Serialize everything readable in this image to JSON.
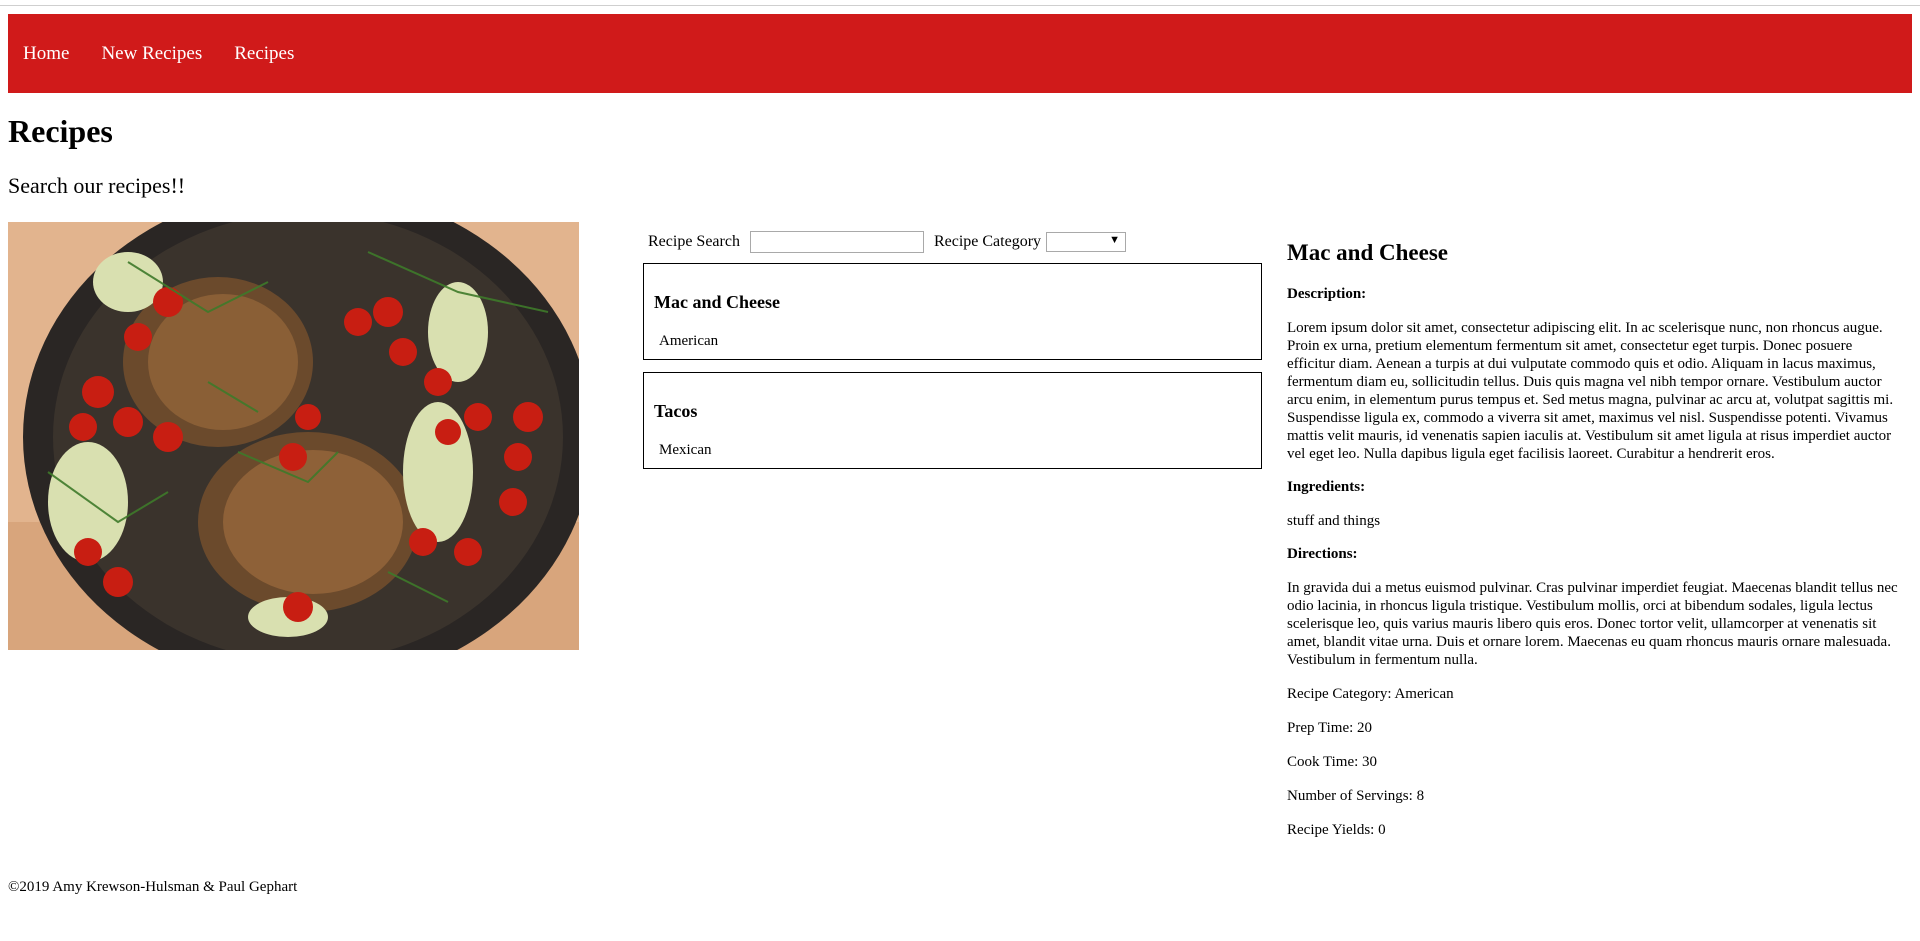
{
  "nav": {
    "items": [
      {
        "label": "Home"
      },
      {
        "label": "New Recipes"
      },
      {
        "label": "Recipes"
      }
    ]
  },
  "page": {
    "title": "Recipes",
    "subtitle": "Search our recipes!!"
  },
  "search": {
    "label": "Recipe Search",
    "value": "",
    "category_label": "Recipe Category",
    "category_value": ""
  },
  "recipes": [
    {
      "name": "Mac and Cheese",
      "category": "American"
    },
    {
      "name": "Tacos",
      "category": "Mexican"
    }
  ],
  "detail": {
    "title": "Mac and Cheese",
    "description_label": "Description:",
    "description": "Lorem ipsum dolor sit amet, consectetur adipiscing elit. In ac scelerisque nunc, non rhoncus augue. Proin ex urna, pretium elementum fermentum sit amet, consectetur eget turpis. Donec posuere efficitur diam. Aenean a turpis at dui vulputate commodo quis et odio. Aliquam in lacus maximus, fermentum diam eu, sollicitudin tellus. Duis quis magna vel nibh tempor ornare. Vestibulum auctor arcu enim, in elementum purus tempus et. Sed metus magna, pulvinar ac arcu at, volutpat sagittis mi. Suspendisse ligula ex, commodo a viverra sit amet, maximus vel nisl. Suspendisse potenti. Vivamus mattis velit mauris, id venenatis sapien iaculis at. Vestibulum sit amet ligula at risus imperdiet auctor vel eget leo. Nulla dapibus ligula eget facilisis laoreet. Curabitur a hendrerit eros.",
    "ingredients_label": "Ingredients:",
    "ingredients": "stuff and things",
    "directions_label": "Directions:",
    "directions": "In gravida dui a metus euismod pulvinar. Cras pulvinar imperdiet feugiat. Maecenas blandit tellus nec odio lacinia, in rhoncus ligula tristique. Vestibulum mollis, orci at bibendum sodales, ligula lectus scelerisque leo, quis varius mauris libero quis eros. Donec tortor velit, ullamcorper at venenatis sit amet, blandit vitae urna. Duis et ornare lorem. Maecenas eu quam rhoncus mauris ornare malesuada. Vestibulum in fermentum nulla.",
    "category": "Recipe Category: American",
    "prep_time": "Prep Time: 20",
    "cook_time": "Cook Time: 30",
    "servings": "Number of Servings: 8",
    "yields": "Recipe Yields: 0"
  },
  "footer": {
    "text": "©2019 Amy Krewson-Hulsman & Paul Gephart"
  },
  "colors": {
    "nav_bg": "#d01a1a",
    "nav_text": "#ffffff"
  },
  "hero_image": {
    "icon": "food-photo-pork-chops-skillet"
  }
}
